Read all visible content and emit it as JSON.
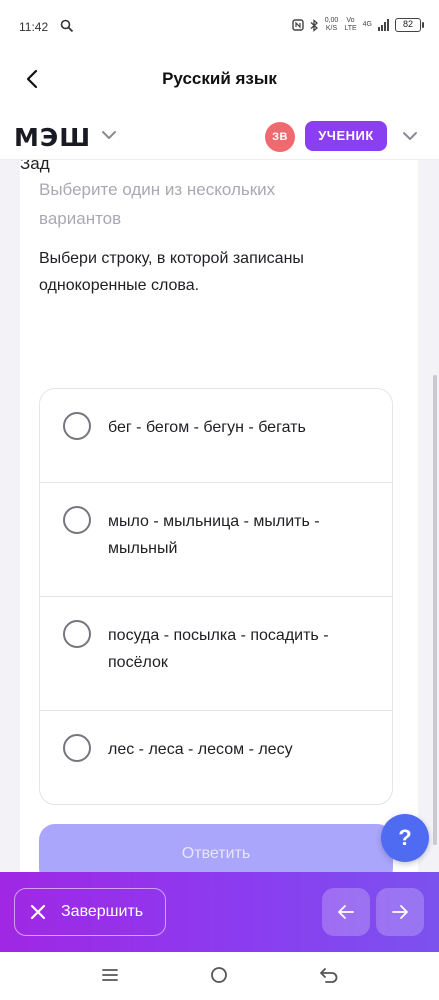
{
  "status_bar": {
    "time": "11:42",
    "net_speed_value": "0,00",
    "net_speed_unit": "K/S",
    "vo_label": "Vo",
    "lte_label": "LTE",
    "gen_label": "4G",
    "battery": "82"
  },
  "header": {
    "title": "Русский язык",
    "back_icon": "arrow-left-icon"
  },
  "mesh": {
    "logo": "МЭШ",
    "avatar_initials": "ЗВ",
    "role": "УЧЕНИК",
    "colors": {
      "avatar": "#f0696f",
      "role_badge": "#8a3ff0"
    }
  },
  "task": {
    "cut_heading": "Зад",
    "hint": "Выберите один из нескольких вариантов",
    "question": "Выбери строку, в которой записаны однокоренные слова.",
    "options": [
      {
        "label": "бег - бегом - бегун - бегать"
      },
      {
        "label": "мыло - мыльница - мылить - мыльный"
      },
      {
        "label": "посуда - посылка - посадить - посёлок"
      },
      {
        "label": "лес - леса - лесом - лесу"
      }
    ],
    "submit_label": "Ответить"
  },
  "help": {
    "label": "?"
  },
  "actions": {
    "finish_label": "Завершить",
    "prev_icon": "arrow-left-icon",
    "next_icon": "arrow-right-icon",
    "colors": {
      "gradient_start": "#a027e4",
      "gradient_end": "#7b52ee"
    }
  },
  "system_nav": {
    "menu_icon": "menu-icon",
    "home_icon": "home-icon",
    "back_icon": "back-icon"
  }
}
